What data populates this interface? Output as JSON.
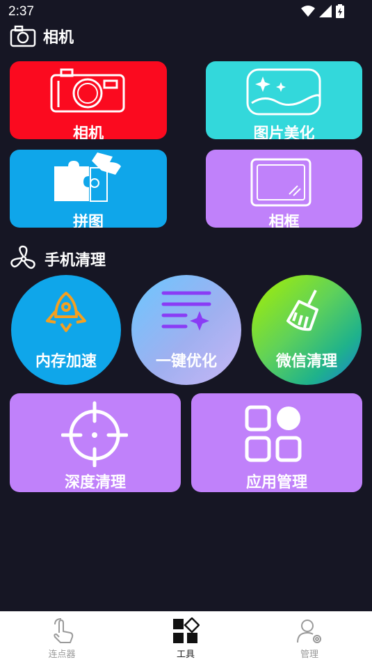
{
  "status_bar": {
    "time": "2:37"
  },
  "camera_section": {
    "title": "相机",
    "cards": [
      {
        "label": "相机",
        "color": "#fb0a1f"
      },
      {
        "label": "图片美化",
        "color": "#33d8db"
      },
      {
        "label": "拼图",
        "color": "#0fa6ea"
      },
      {
        "label": "相框",
        "color": "#c081fa"
      }
    ]
  },
  "phone_clean_section": {
    "title": "手机清理",
    "circles": [
      {
        "label": "内存加速"
      },
      {
        "label": "一键优化"
      },
      {
        "label": "微信清理"
      }
    ],
    "cards": [
      {
        "label": "深度清理",
        "color": "#c081fa"
      },
      {
        "label": "应用管理",
        "color": "#c081fa"
      }
    ]
  },
  "bottom_nav": {
    "items": [
      {
        "label": "连点器",
        "icon": "hand-tap-icon",
        "active": false
      },
      {
        "label": "工具",
        "icon": "tools-grid-icon",
        "active": true
      },
      {
        "label": "管理",
        "icon": "user-settings-icon",
        "active": false
      }
    ]
  }
}
